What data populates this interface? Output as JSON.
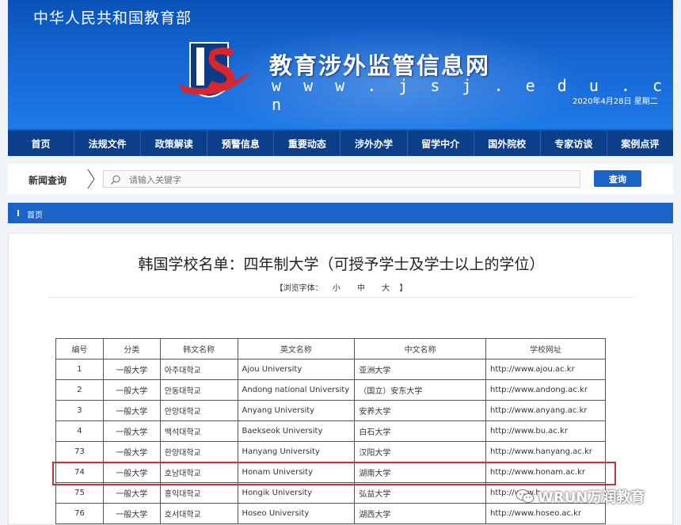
{
  "header": {
    "ministry": "中华人民共和国教育部",
    "site_title": "教育涉外监管信息网",
    "site_url": "w w w . j s j . e d u . c n",
    "date": "2020年4月28日 星期二"
  },
  "nav": {
    "items": [
      "首页",
      "法规文件",
      "政策解读",
      "预警信息",
      "重要动态",
      "涉外办学",
      "留学中介",
      "国外院校",
      "专家访谈",
      "案例点评"
    ]
  },
  "search": {
    "label": "新闻查询",
    "placeholder": "请输入关键字",
    "button": "查询"
  },
  "breadcrumb": {
    "home": "首页"
  },
  "article": {
    "title": "韩国学校名单：四年制大学（可授予学士及学士以上的学位）",
    "font_size": {
      "label": "【浏览字体：",
      "small": "小",
      "medium": "中",
      "large": "大",
      "close": "】"
    }
  },
  "table": {
    "headers": [
      "编号",
      "分类",
      "韩文名称",
      "英文名称",
      "中文名称",
      "学校网址"
    ],
    "rows": [
      [
        "1",
        "一般大学",
        "아주대학교",
        "Ajou  University",
        "亚洲大学",
        "http://www.ajou.ac.kr"
      ],
      [
        "2",
        "一般大学",
        "안동대학교",
        "Andong national  University",
        "（国立）安东大学",
        "http://www.andong.ac.kr"
      ],
      [
        "3",
        "一般大学",
        "안양대학교",
        "Anyang  University",
        "安养大学",
        "http://www.anyang.ac.kr"
      ],
      [
        "4",
        "一般大学",
        "백석대학교",
        "Baekseok  University",
        "白石大学",
        "http://www.bu.ac.kr"
      ],
      [
        "73",
        "一般大学",
        "한양대학교",
        "Hanyang  University",
        "汉阳大学",
        "http://www.hanyang.ac.kr"
      ],
      [
        "74",
        "一般大学",
        "호남대학교",
        "Honam  University",
        "湖南大学",
        "http://www.honam.ac.kr"
      ],
      [
        "75",
        "一般大学",
        "홍익대학교",
        "Hongik  University",
        "弘益大学",
        "http://www.h"
      ],
      [
        "76",
        "一般大学",
        "호서대학교",
        "Hoseo  University",
        "湖西大学",
        "http://www.hoseo.ac.kr"
      ]
    ]
  },
  "watermark": {
    "text": "WRUN万润教育"
  },
  "colors": {
    "header_blue": "#1566d2",
    "nav_blue": "#0c3f8a",
    "highlight_red": "#c8323a"
  }
}
